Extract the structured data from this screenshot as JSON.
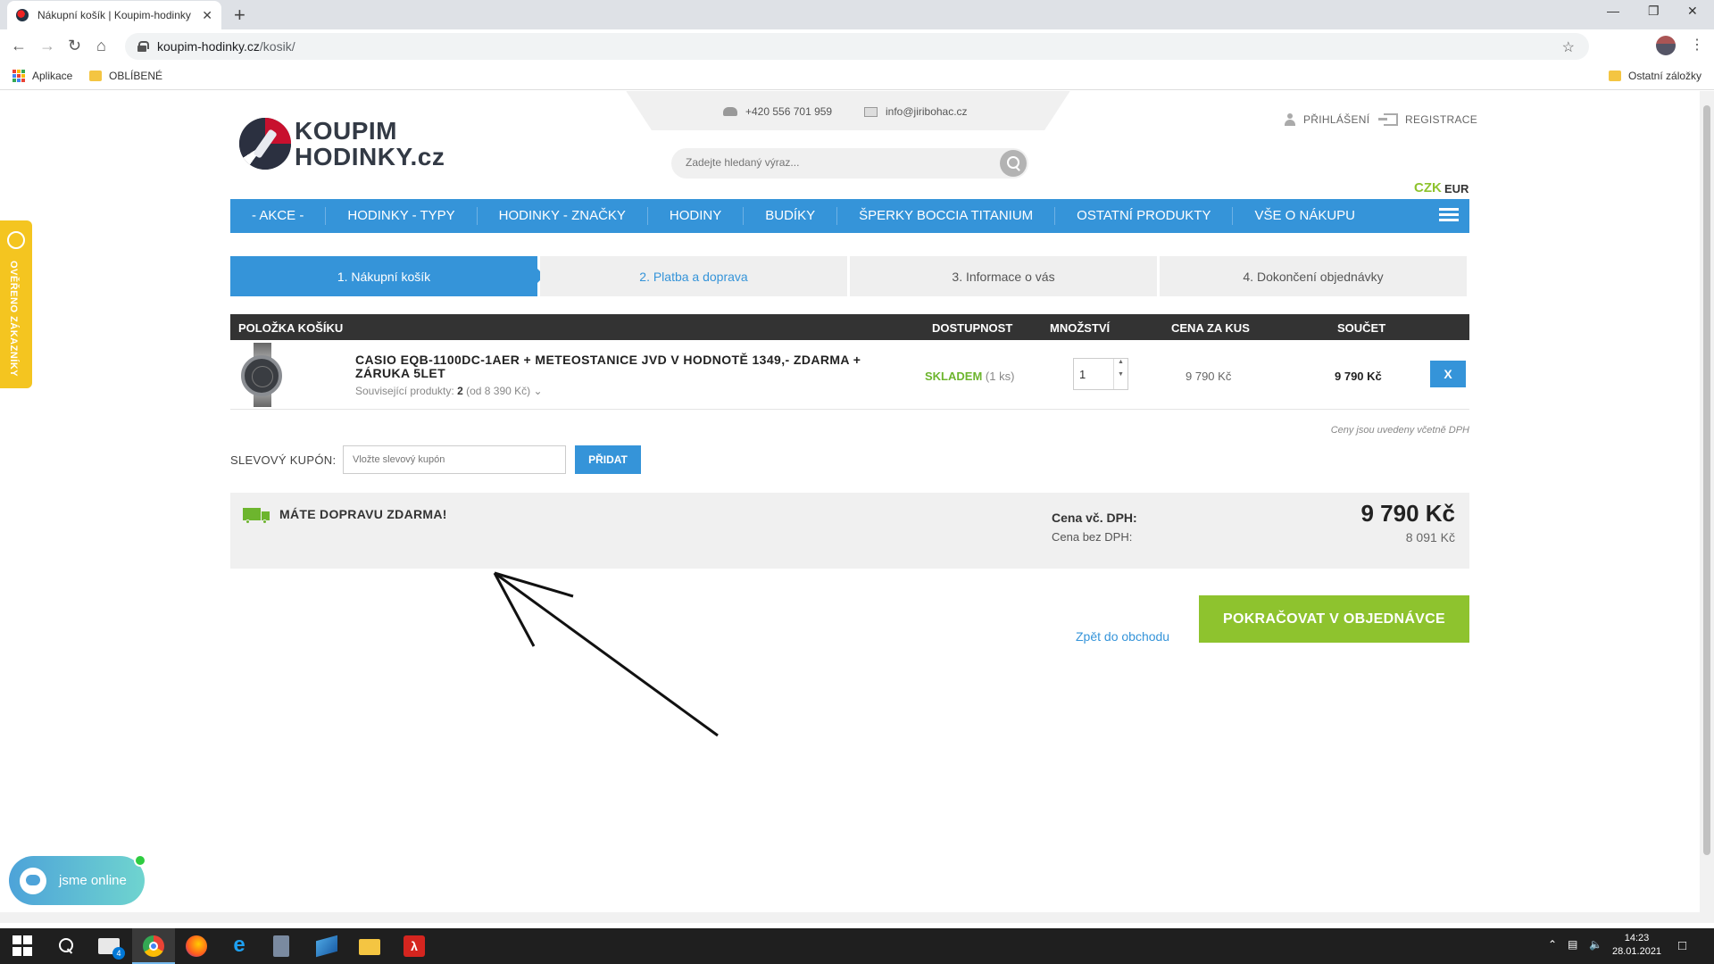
{
  "browser": {
    "tab_title": "Nákupní košík | Koupim-hodinky",
    "tab_close": "✕",
    "new_tab": "+",
    "url_host": "koupim-hodinky.cz",
    "url_path": "/kosik/",
    "bookmarks": {
      "apps": "Aplikace",
      "favorites": "OBLÍBENÉ",
      "other": "Ostatní záložky"
    }
  },
  "header": {
    "logo_line1": "KOUPIM",
    "logo_line2": "HODINKY.cz",
    "phone": "+420 556 701 959",
    "email": "info@jiribohac.cz",
    "search_placeholder": "Zadejte hledaný výraz...",
    "login": "PŘIHLÁŠENÍ",
    "register": "REGISTRACE",
    "currency_active": "CZK",
    "currency_other": "EUR",
    "colors": {
      "brand_blue": "#3594d9",
      "green": "#8ec32e",
      "stock_green": "#6db52e"
    }
  },
  "nav": [
    "- AKCE -",
    "HODINKY - TYPY",
    "HODINKY - ZNAČKY",
    "HODINY",
    "BUDÍKY",
    "ŠPERKY BOCCIA TITANIUM",
    "OSTATNÍ PRODUKTY",
    "VŠE O NÁKUPU"
  ],
  "steps": [
    "1. Nákupní košík",
    "2. Platba a doprava",
    "3. Informace o vás",
    "4. Dokončení objednávky"
  ],
  "cart": {
    "headers": {
      "item": "POLOŽKA KOŠÍKU",
      "availability": "DOSTUPNOST",
      "quantity": "MNOŽSTVÍ",
      "unit_price": "CENA ZA KUS",
      "total": "SOUČET"
    },
    "items": [
      {
        "name": "CASIO EQB-1100DC-1AER + METEOSTANICE JVD V HODNOTĚ 1349,- ZDARMA + ZÁRUKA 5LET",
        "related_label": "Související produkty:",
        "related_count": "2",
        "related_from": "(od 8 390 Kč)",
        "stock": "SKLADEM",
        "stock_qty": "(1 ks)",
        "quantity": "1",
        "unit_price": "9 790 Kč",
        "total": "9 790 Kč",
        "remove": "X"
      }
    ],
    "vat_note": "Ceny jsou uvedeny včetně DPH"
  },
  "coupon": {
    "label": "SLEVOVÝ KUPÓN:",
    "placeholder": "Vložte slevový kupón",
    "button": "PŘIDAT"
  },
  "summary": {
    "free_shipping": "MÁTE DOPRAVU ZDARMA!",
    "with_vat_label": "Cena vč. DPH:",
    "without_vat_label": "Cena bez DPH:",
    "with_vat": "9 790 Kč",
    "without_vat": "8 091 Kč"
  },
  "actions": {
    "back": "Zpět do obchodu",
    "continue": "POKRAČOVAT V OBJEDNÁVCE"
  },
  "widgets": {
    "verified": "OVĚŘENO ZÁKAZNÍKY",
    "chat": "jsme online"
  },
  "taskbar": {
    "time": "14:23",
    "date": "28.01.2021",
    "mail_badge": "4"
  }
}
